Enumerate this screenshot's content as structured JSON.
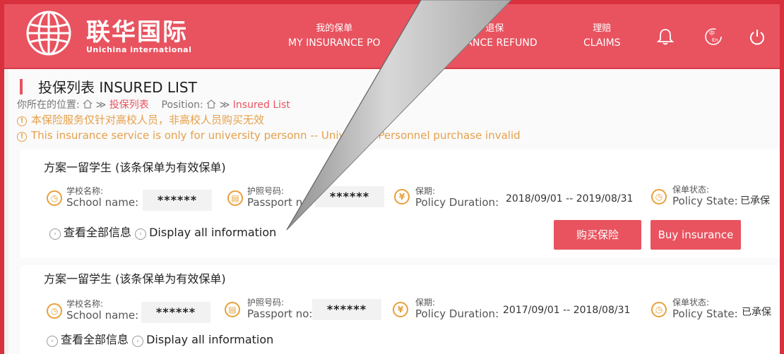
{
  "header": {
    "brand_cn": "联华国际",
    "brand_en": "Unichina international",
    "nav": [
      {
        "cn": "我的保单",
        "en": "MY INSURANCE PO"
      },
      {
        "cn": "退保",
        "en": "URANCE REFUND"
      },
      {
        "cn": "理赔",
        "en": "CLAIMS"
      }
    ],
    "lang_icon_text": "En"
  },
  "page": {
    "title": "投保列表  INSURED LIST",
    "crumb_cn_prefix": "你所在的位置:",
    "crumb_cn_current": "投保列表",
    "crumb_en_prefix": "Position:",
    "crumb_en_current": "Insured List",
    "warning_cn": "本保险服务仅针对高校人员，非高校人员购买无效",
    "warning_en": "This insurance service is only for university personn          -- University Personnel purchase invalid"
  },
  "policies": [
    {
      "title": "方案一留学生  (该条保单为有效保单)",
      "school_cn": "学校名称:",
      "school_en": "School name:",
      "school_value": "******",
      "passport_cn": "护照号码:",
      "passport_en": "Passport no:",
      "passport_value": "******",
      "duration_cn": "保期:",
      "duration_en": "Policy Duration:",
      "duration_value": "2018/09/01 -- 2019/08/31",
      "state_cn": "保单状态:",
      "state_en": "Policy State:",
      "state_value": "已承保",
      "more_cn": "查看全部信息",
      "more_en": "Display all information",
      "buy_cn": "购买保险",
      "buy_en": "Buy insurance"
    },
    {
      "title": "方案一留学生  (该条保单为有效保单)",
      "school_cn": "学校名称:",
      "school_en": "School name:",
      "school_value": "******",
      "passport_cn": "护照号码:",
      "passport_en": "Passport no:",
      "passport_value": "******",
      "duration_cn": "保期:",
      "duration_en": "Policy Duration:",
      "duration_value": "2017/09/01 -- 2018/08/31",
      "state_cn": "保单状态:",
      "state_en": "Policy State:",
      "state_value": "已承保",
      "more_cn": "查看全部信息",
      "more_en": "Display all information"
    }
  ],
  "colors": {
    "brand": "#e8535f",
    "warning": "#e6a04a",
    "icon": "#e8a13a"
  },
  "icons": [
    "globe-logo-icon",
    "bell-icon",
    "language-icon",
    "power-icon",
    "home-icon",
    "warning-icon",
    "clock-icon",
    "passport-icon",
    "yen-icon",
    "chevron-right-icon"
  ]
}
